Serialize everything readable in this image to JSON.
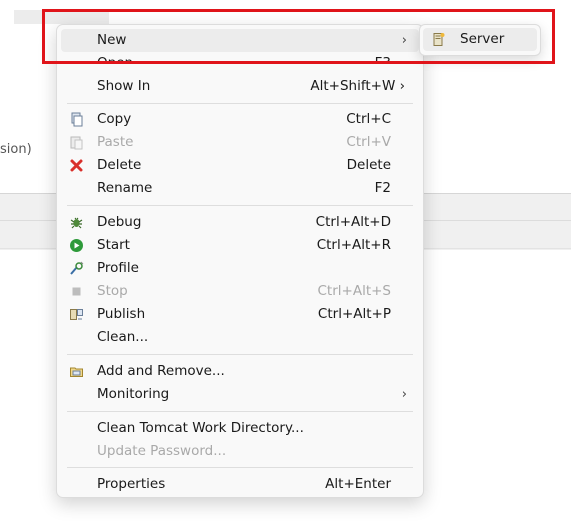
{
  "background": {
    "partial_label": "sion)"
  },
  "menu": {
    "items": [
      {
        "label": "New",
        "shortcut": "",
        "arrow": "›",
        "icon": "",
        "disabled": false
      },
      {
        "label": "Open",
        "shortcut": "F3",
        "icon": "",
        "disabled": false
      },
      {
        "label": "Show In",
        "shortcut": "Alt+Shift+W ›",
        "icon": "",
        "disabled": false
      },
      {
        "label": "Copy",
        "shortcut": "Ctrl+C",
        "icon": "copy-icon",
        "disabled": false
      },
      {
        "label": "Paste",
        "shortcut": "Ctrl+V",
        "icon": "paste-icon",
        "disabled": true
      },
      {
        "label": "Delete",
        "shortcut": "Delete",
        "icon": "delete-icon",
        "disabled": false
      },
      {
        "label": "Rename",
        "shortcut": "F2",
        "icon": "",
        "disabled": false
      },
      {
        "label": "Debug",
        "shortcut": "Ctrl+Alt+D",
        "icon": "debug-icon",
        "disabled": false
      },
      {
        "label": "Start",
        "shortcut": "Ctrl+Alt+R",
        "icon": "start-icon",
        "disabled": false
      },
      {
        "label": "Profile",
        "shortcut": "",
        "icon": "profile-icon",
        "disabled": false
      },
      {
        "label": "Stop",
        "shortcut": "Ctrl+Alt+S",
        "icon": "stop-icon",
        "disabled": true
      },
      {
        "label": "Publish",
        "shortcut": "Ctrl+Alt+P",
        "icon": "publish-icon",
        "disabled": false
      },
      {
        "label": "Clean...",
        "shortcut": "",
        "icon": "",
        "disabled": false
      },
      {
        "label": "Add and Remove...",
        "shortcut": "",
        "icon": "add-remove-icon",
        "disabled": false
      },
      {
        "label": "Monitoring",
        "shortcut": "",
        "arrow": "›",
        "icon": "",
        "disabled": false
      },
      {
        "label": "Clean Tomcat Work Directory...",
        "shortcut": "",
        "icon": "",
        "disabled": false
      },
      {
        "label": "Update Password...",
        "shortcut": "",
        "icon": "",
        "disabled": true
      },
      {
        "label": "Properties",
        "shortcut": "Alt+Enter",
        "icon": "",
        "disabled": false
      }
    ]
  },
  "submenu": {
    "items": [
      {
        "label": "Server",
        "icon": "server-icon"
      }
    ]
  },
  "colors": {
    "highlight_border": "#e0141a",
    "delete_icon": "#d9302b",
    "start_icon": "#2e9a3a",
    "disabled_text": "#a9a9a9"
  }
}
